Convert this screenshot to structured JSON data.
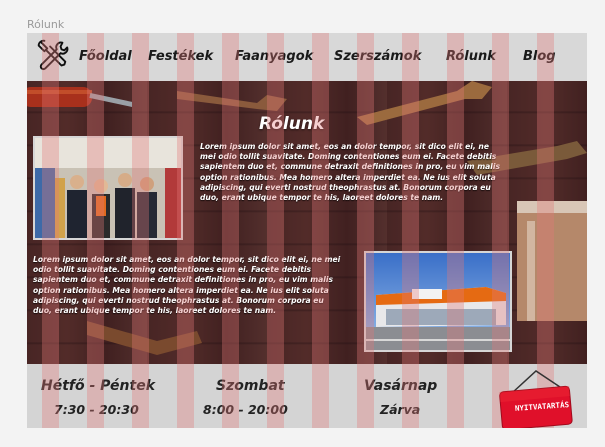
{
  "window": {
    "title": "Rólunk"
  },
  "nav": {
    "items": [
      {
        "label": "Főoldal"
      },
      {
        "label": "Festékek"
      },
      {
        "label": "Faanyagok"
      },
      {
        "label": "Szerszámok"
      },
      {
        "label": "Rólunk"
      },
      {
        "label": "Blog"
      }
    ]
  },
  "main": {
    "heading": "Rólunk",
    "paragraph_1": "Lorem ipsum dolor sit amet, eos an dolor tempor, sit dico elit ei, ne mei odio tollit suavitate. Doming contentiones eum ei. Facete debitis sapientem duo et, commune detraxit definitiones in pro, eu vim malis option rationibus. Mea homero altera imperdiet ea. Ne ius elit soluta adipiscing, qui everti nostrud theophrastus at. Bonorum corpora eu duo, erant ubique tempor te his, laoreet dolores te nam.",
    "paragraph_2": "Lorem ipsum dolor sit amet, eos an dolor tempor, sit dico elit ei, ne mei odio tollit suavitate. Doming contentiones eum ei. Facete debitis sapientem duo et, commune detraxit definitiones in pro, eu vim malis option rationibus. Mea homero altera imperdiet ea. Ne ius elit soluta adipiscing, qui everti nostrud theophrastus at. Bonorum corpora eu duo, erant ubique tempor te his, laoreet dolores te nam."
  },
  "hours": {
    "weekday_label": "Hétfő - Péntek",
    "weekday_value": "7:30 - 20:30",
    "saturday_label": "Szombat",
    "saturday_value": "8:00 - 20:00",
    "sunday_label": "Vasárnap",
    "sunday_value": "Zárva"
  },
  "open_sign": {
    "label": "NYITVATARTÁS"
  },
  "icons": {
    "logo": "tools-logo-icon",
    "photo_team": "team-photo",
    "photo_store": "store-photo"
  },
  "colors": {
    "grid_overlay": "#e17878",
    "wood": "#4a2a23",
    "sign_red": "#e0102a",
    "nav_bg": "#d8d8d8"
  }
}
